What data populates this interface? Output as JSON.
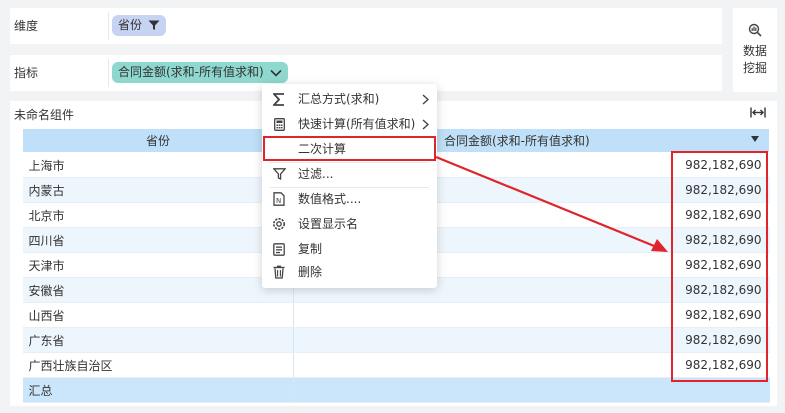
{
  "fields": {
    "dimension_label": "维度",
    "dimension_pill": "省份",
    "indicator_label": "指标",
    "indicator_pill": "合同金额(求和-所有值求和)"
  },
  "data_mining": {
    "label": "数据挖掘"
  },
  "widget": {
    "title": "未命名组件",
    "columns": [
      "省份",
      "合同金额(求和-所有值求和)"
    ],
    "rows": [
      {
        "province": "上海市",
        "value": "982,182,690"
      },
      {
        "province": "内蒙古",
        "value": "982,182,690"
      },
      {
        "province": "北京市",
        "value": "982,182,690"
      },
      {
        "province": "四川省",
        "value": "982,182,690"
      },
      {
        "province": "天津市",
        "value": "982,182,690"
      },
      {
        "province": "安徽省",
        "value": "982,182,690"
      },
      {
        "province": "山西省",
        "value": "982,182,690"
      },
      {
        "province": "广东省",
        "value": "982,182,690"
      },
      {
        "province": "广西壮族自治区",
        "value": "982,182,690"
      }
    ],
    "total_label": "汇总",
    "total_value": ""
  },
  "context_menu": {
    "items": [
      {
        "label": "汇总方式(求和)",
        "icon": "sigma-icon",
        "submenu": true
      },
      {
        "label": "快速计算(所有值求和)",
        "icon": "calculator-icon",
        "submenu": true
      },
      {
        "label": "二次计算",
        "icon": "",
        "submenu": false,
        "highlighted": true
      },
      {
        "label": "过滤...",
        "icon": "filter-icon",
        "submenu": false
      },
      {
        "label": "数值格式....",
        "icon": "number-format-icon",
        "submenu": false
      },
      {
        "label": "设置显示名",
        "icon": "gear-icon",
        "submenu": false
      },
      {
        "label": "复制",
        "icon": "copy-icon",
        "submenu": false
      },
      {
        "label": "删除",
        "icon": "trash-icon",
        "submenu": false
      }
    ]
  },
  "colors": {
    "dimension_pill": "#c7d3f2",
    "indicator_pill": "#8fd8cf",
    "table_header": "#bfe0f8",
    "highlight_red": "#e0242b"
  }
}
